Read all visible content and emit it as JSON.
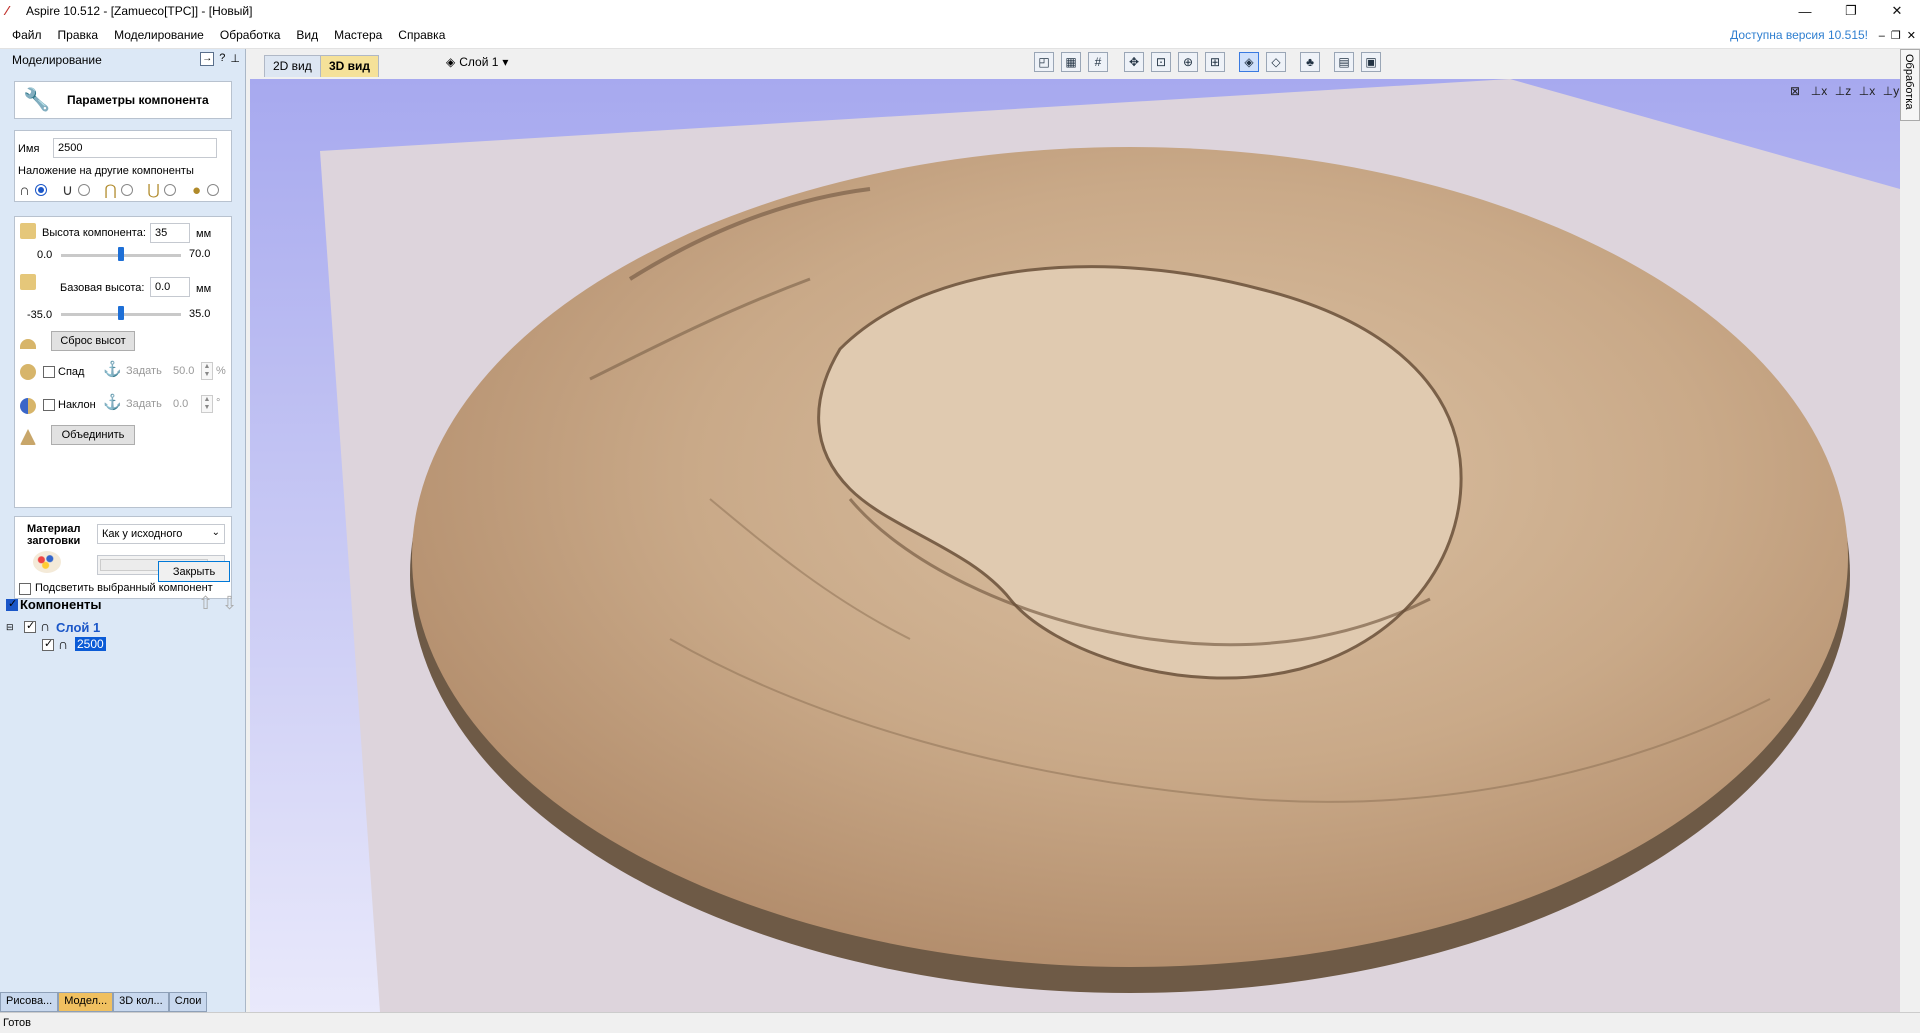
{
  "window": {
    "title": "Aspire 10.512 - [Zamueco[TPC]] - [Новый]"
  },
  "menu": [
    "Файл",
    "Правка",
    "Моделирование",
    "Обработка",
    "Вид",
    "Мастера",
    "Справка"
  ],
  "update_link": "Доступна версия 10.515!",
  "panel": {
    "header": "Моделирование",
    "component_params_button": "Параметры компонента",
    "name_label": "Имя",
    "name_value": "2500",
    "combine_label": "Наложение на другие компоненты",
    "height_label": "Высота компонента:",
    "height_value": "35",
    "height_unit": "мм",
    "height_min": "0.0",
    "height_max": "70.0",
    "height_slider_fraction": 0.5,
    "base_label": "Базовая высота:",
    "base_value": "0.0",
    "base_unit": "мм",
    "base_min": "-35.0",
    "base_max": "35.0",
    "base_slider_fraction": 0.5,
    "reset_button": "Сброс высот",
    "fade_label": "Спад",
    "fade_set": "Задать",
    "fade_value": "50.0",
    "fade_unit": "%",
    "tilt_label": "Наклон",
    "tilt_set": "Задать",
    "tilt_value": "0.0",
    "tilt_unit": "°",
    "merge_button": "Объединить",
    "material_label_1": "Материал",
    "material_label_2": "заготовки",
    "material_value": "Как у исходного",
    "highlight_label": "Подсветить выбранный компонент",
    "close_button": "Закрыть"
  },
  "components": {
    "title": "Компоненты",
    "layer": "Слой 1",
    "item": "2500"
  },
  "bottom_tabs": [
    "Рисова...",
    "Модел...",
    "3D кол...",
    "Слои"
  ],
  "view_tabs": [
    "2D вид",
    "3D вид"
  ],
  "layer_select": "Слой 1",
  "right_tab": "Обработка",
  "status": "Готов",
  "colors": {
    "relief": "#c9a988",
    "relief_edge": "#6e5a46",
    "background_top": "#a7a9ef",
    "plane": "#ddd4dc"
  }
}
